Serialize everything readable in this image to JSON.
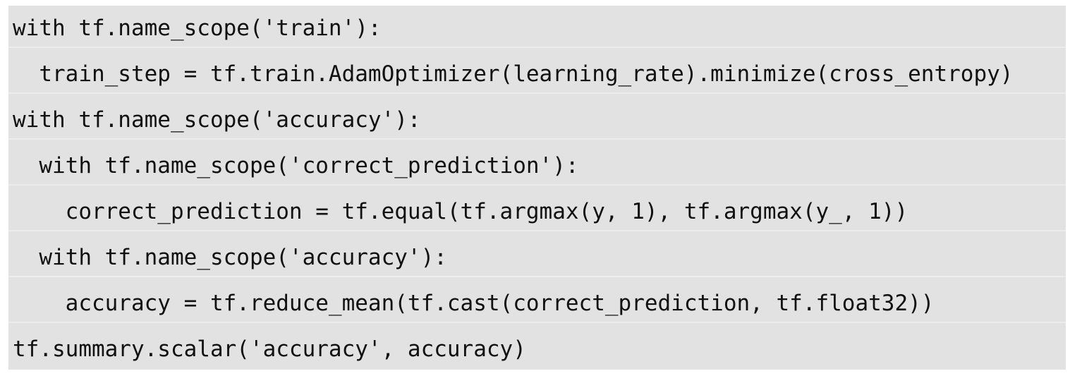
{
  "code": {
    "lines": [
      "with tf.name_scope('train'):",
      "  train_step = tf.train.AdamOptimizer(learning_rate).minimize(cross_entropy)",
      "with tf.name_scope('accuracy'):",
      "  with tf.name_scope('correct_prediction'):",
      "    correct_prediction = tf.equal(tf.argmax(y, 1), tf.argmax(y_, 1))",
      "  with tf.name_scope('accuracy'):",
      "    accuracy = tf.reduce_mean(tf.cast(correct_prediction, tf.float32))",
      "tf.summary.scalar('accuracy', accuracy)"
    ],
    "background_color": "#e2e2e2",
    "text_color": "#111111"
  }
}
